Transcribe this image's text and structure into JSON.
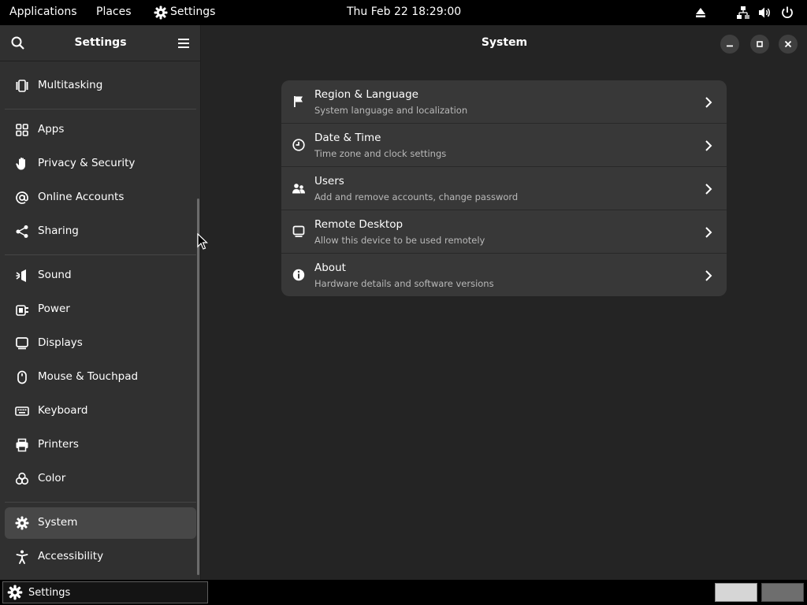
{
  "topbar": {
    "applications": "Applications",
    "places": "Places",
    "settings": "Settings",
    "clock": "Thu Feb 22  18:29:00",
    "icons": [
      "eject-icon",
      "network-icon",
      "volume-icon",
      "power-icon"
    ]
  },
  "sidebar": {
    "title": "Settings",
    "items": [
      {
        "label": "Multitasking",
        "icon": "multitasking-icon"
      },
      {
        "label": "Apps",
        "icon": "apps-icon"
      },
      {
        "label": "Privacy & Security",
        "icon": "hand-icon"
      },
      {
        "label": "Online Accounts",
        "icon": "at-sign-icon"
      },
      {
        "label": "Sharing",
        "icon": "share-icon"
      },
      {
        "label": "Sound",
        "icon": "speaker-icon"
      },
      {
        "label": "Power",
        "icon": "plug-icon"
      },
      {
        "label": "Displays",
        "icon": "monitor-icon"
      },
      {
        "label": "Mouse & Touchpad",
        "icon": "mouse-icon"
      },
      {
        "label": "Keyboard",
        "icon": "keyboard-icon"
      },
      {
        "label": "Printers",
        "icon": "printer-icon"
      },
      {
        "label": "Color",
        "icon": "color-icon"
      },
      {
        "label": "System",
        "icon": "gear-icon",
        "selected": true
      },
      {
        "label": "Accessibility",
        "icon": "accessibility-icon"
      }
    ]
  },
  "main": {
    "title": "System",
    "rows": [
      {
        "title": "Region & Language",
        "subtitle": "System language and localization",
        "icon": "flag-icon"
      },
      {
        "title": "Date & Time",
        "subtitle": "Time zone and clock settings",
        "icon": "clock-icon"
      },
      {
        "title": "Users",
        "subtitle": "Add and remove accounts, change password",
        "icon": "users-icon"
      },
      {
        "title": "Remote Desktop",
        "subtitle": "Allow this device to be used remotely",
        "icon": "remote-desktop-icon"
      },
      {
        "title": "About",
        "subtitle": "Hardware details and software versions",
        "icon": "info-icon"
      }
    ]
  },
  "taskbar": {
    "task_label": "Settings"
  },
  "colors": {
    "background": "#242424",
    "sidebar": "#303030",
    "selected": "#474747",
    "card": "#383838"
  }
}
